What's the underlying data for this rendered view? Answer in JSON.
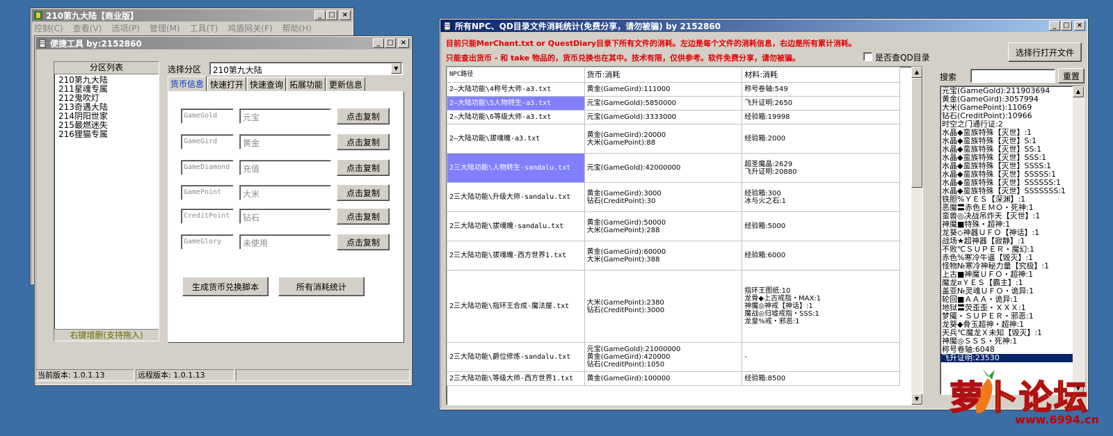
{
  "main_window": {
    "title": "210第九大陆【商业版】",
    "menu": [
      "控制(C)",
      "查看(V)",
      "选项(P)",
      "管理(M)",
      "工具(T)",
      "鸡盾网关(F)",
      "帮助(H)"
    ]
  },
  "tool_window": {
    "title": "便捷工具   by:2152860",
    "list_title": "分区列表",
    "zones": [
      "210第九大陆",
      "211星魂专属",
      "212鬼吹灯",
      "213奇遇大陆",
      "214阴阳世家",
      "215最燃迷失",
      "216狸猫专属"
    ],
    "list_footer": "右键增删(支持拖入)",
    "select_label": "选择分区",
    "select_value": "210第九大陆",
    "tabs": [
      "货币信息",
      "快速打开",
      "快速查询",
      "拓展功能",
      "更新信息"
    ],
    "currency_rows": [
      {
        "key": "GameGold",
        "name": "元宝",
        "button": "点击复制"
      },
      {
        "key": "GameGird",
        "name": "黄金",
        "button": "点击复制"
      },
      {
        "key": "GameDiamond",
        "name": "充值",
        "button": "点击复制"
      },
      {
        "key": "GamePoint",
        "name": "大米",
        "button": "点击复制"
      },
      {
        "key": "CreditPoint",
        "name": "钻石",
        "button": "点击复制"
      },
      {
        "key": "GameGlory",
        "name": "未使用",
        "button": "点击复制"
      }
    ],
    "btn_generate": "生成货币兑换脚本",
    "btn_all_stats": "所有消耗统计",
    "status_current": "当前版本: 1.0.1.13",
    "status_remote": "远程版本: 1.0.1.13"
  },
  "stats_window": {
    "title": "所有NPC、QD目录文件消耗统计(免费分享，请勿被骗)      by 2152860",
    "notice1": "目前只能MerChant.txt or QuestDiary目录下所有文件的消耗。左边是每个文件的消耗信息，右边是所有累计消耗。",
    "notice2": "只能查出货币 - 和 take 物品的，货币兑换也在其中。技术有限，仅供参考。软件免费分享，请勿被骗。",
    "checkbox_label": "是否查QD目录",
    "btn_select_file": "选择行打开文件",
    "search_label": "搜索",
    "btn_reset": "重置",
    "columns": [
      "NPC路径",
      "货币:消耗",
      "材料:消耗"
    ],
    "rows": [
      {
        "path": "2—大陆功能\\4称号大师-a3.txt",
        "currency": [
          "黄金(GameGird):111000"
        ],
        "material": [
          "称号卷轴:549"
        ],
        "hl": false
      },
      {
        "path": "2—大陆功能\\5人物转生-a3.txt",
        "currency": [
          "元宝(GameGold):5850000"
        ],
        "material": [
          "飞升证明:2650"
        ],
        "hl": true
      },
      {
        "path": "2—大陆功能\\6等级大师-a3.txt",
        "currency": [
          "元宝(GameGold):3333000"
        ],
        "material": [
          "经验箱:19998"
        ],
        "hl": false
      },
      {
        "path": "2—大陆功能\\拔魂魄-a3.txt",
        "currency": [
          "黄金(GameGird):20000",
          "大米(GamePoint):88"
        ],
        "material": [
          "经验箱:2000"
        ],
        "hl": false
      },
      {
        "path": "2三大陆功能\\人物转生-sandalu.txt",
        "currency": [
          "元宝(GameGold):42000000"
        ],
        "material": [
          "超圣魔晶:2629",
          "飞升证明:20880"
        ],
        "hl": true
      },
      {
        "path": "2三大陆功能\\升级大师-sandalu.txt",
        "currency": [
          "黄金(GameGird):3000",
          "钻石(CreditPoint):30"
        ],
        "material": [
          "经验箱:300",
          "冰与火之石:1"
        ],
        "hl": false
      },
      {
        "path": "2三大陆功能\\拔魂魄-sandalu.txt",
        "currency": [
          "黄金(GameGird):50000",
          "大米(GamePoint):288"
        ],
        "material": [
          "经验箱:5000"
        ],
        "hl": false
      },
      {
        "path": "2三大陆功能\\拔魂魄-西方世界1.txt",
        "currency": [
          "黄金(GameGird):60000",
          "大米(GamePoint):388"
        ],
        "material": [
          "经验箱:6000"
        ],
        "hl": false
      },
      {
        "path": "2三大陆功能\\指环王合成-魔法屋.txt",
        "currency": [
          "大米(GamePoint):2380",
          "钻石(CreditPoint):3000"
        ],
        "material": [
          "指环王图纸:10",
          "龙骨◆上古戒指・MAX:1",
          "神魔◎神戒【神话】:1",
          "魔战◎归墟戒指・SSS:1",
          "龙皇%戒・邪恶:1"
        ],
        "hl": false
      },
      {
        "path": "2三大陆功能\\爵位修炼-sandalu.txt",
        "currency": [
          "元宝(GameGold):21000000",
          "黄金(GameGird):420000",
          "钻石(CreditPoint):1050"
        ],
        "material": [
          "-"
        ],
        "hl": false
      },
      {
        "path": "2三大陆功能\\等级大师-西方世界1.txt",
        "currency": [
          "黄金(GameGird):100000"
        ],
        "material": [
          "经验箱:8500"
        ],
        "hl": false
      }
    ],
    "totals": [
      "元宝(GameGold):211903694",
      "黄金(GameGird):3057994",
      "大米(GamePoint):11069",
      "钻石(CreditPoint):10966",
      "时空之门通行证:2",
      "水晶◆蛮族特殊【灭世】:1",
      "水晶◆蛮族特殊【灭世】S:1",
      "水晶◆蛮族特殊【灭世】SS:1",
      "水晶◆蛮族特殊【灭世】SSS:1",
      "水晶◆蛮族特殊【灭世】SSSS:1",
      "水晶◆蛮族特殊【灭世】SSSSS:1",
      "水晶◆蛮族特殊【灭世】SSSSSS:1",
      "水晶◆蛮族特殊【灭世】SSSSSSS:1",
      "铁胆%ＹＥＳ【深渊】:1",
      "恶魔〓赤色ＥＭＯ・死神:1",
      "蛮兽◎决战吊炸天【灭世】:1",
      "神魔■特殊・超神:1",
      "龙葵◇神器ＵＦＯ【神话】:1",
      "战场★超神器【寂静】:1",
      "不败℃ＳＵＰＥＲ・魔幻:1",
      "赤色%寒冷牛逼【毁灭】:1",
      "怪物№寒冷神秘力量【究极】:1",
      "上古■神魔ＵＦＯ・超神:1",
      "魔龙¤ＹＥＳ【霸主】:1",
      "盖亚№灵魂ＵＦＯ・诡异:1",
      "轮回■ＡＡＡ・诡异:1",
      "地狱〓荧歪歪・ＸＸＸ:1",
      "梦魇・ＳＵＰＥＲ・邪恶:1",
      "龙葵◆骨玉超神・超神:1",
      "天兵℃魔龙Ｘ未知【毁灭】:1",
      "神魔◎ＳＳＳ・死神:1",
      "称号卷轴:6048",
      "飞升证明:23530"
    ]
  },
  "watermark": {
    "text": "萝卜论坛",
    "url": "www.6994.cn"
  }
}
